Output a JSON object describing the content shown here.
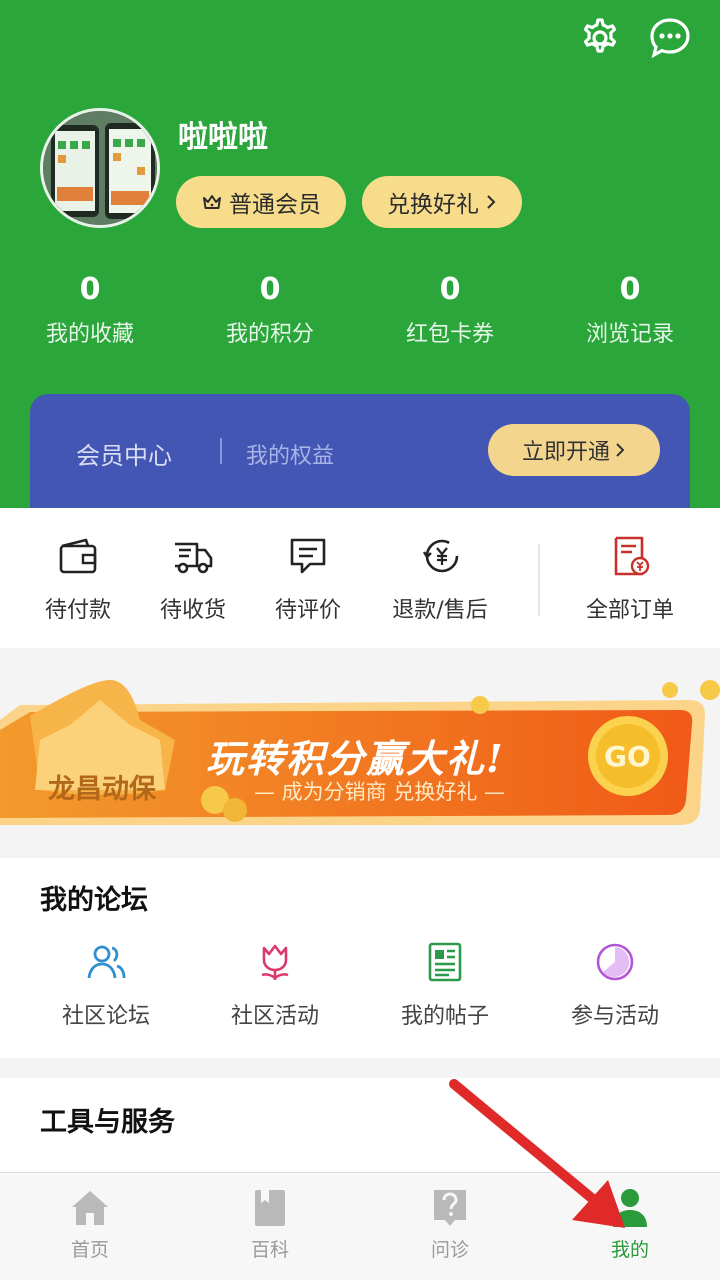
{
  "profile": {
    "username": "啦啦啦",
    "member_label": "普通会员",
    "gift_label": "兑换好礼"
  },
  "stats": [
    {
      "value": "0",
      "label": "我的收藏"
    },
    {
      "value": "0",
      "label": "我的积分"
    },
    {
      "value": "0",
      "label": "红包卡券"
    },
    {
      "value": "0",
      "label": "浏览记录"
    }
  ],
  "vip": {
    "title": "会员中心",
    "subtitle": "我的权益",
    "button": "立即开通"
  },
  "orders": [
    {
      "label": "待付款",
      "icon": "wallet-icon"
    },
    {
      "label": "待收货",
      "icon": "truck-icon"
    },
    {
      "label": "待评价",
      "icon": "comment-icon"
    },
    {
      "label": "退款/售后",
      "icon": "refund-icon"
    },
    {
      "label": "全部订单",
      "icon": "receipt-icon"
    }
  ],
  "banner": {
    "brand": "龙昌动保",
    "headline": "玩转积分赢大礼!",
    "subline": "— 成为分销商 兑换好礼 —",
    "go": "GO"
  },
  "forum": {
    "title": "我的论坛",
    "items": [
      {
        "label": "社区论坛",
        "icon": "people-icon"
      },
      {
        "label": "社区活动",
        "icon": "tulip-icon"
      },
      {
        "label": "我的帖子",
        "icon": "newspaper-icon"
      },
      {
        "label": "参与活动",
        "icon": "pie-icon"
      }
    ]
  },
  "tools": {
    "title": "工具与服务"
  },
  "tabbar": [
    {
      "label": "首页",
      "icon": "home-icon"
    },
    {
      "label": "百科",
      "icon": "book-icon"
    },
    {
      "label": "问诊",
      "icon": "question-icon"
    },
    {
      "label": "我的",
      "icon": "person-icon",
      "active": true
    }
  ],
  "colors": {
    "header_green": "#2aa63a",
    "vip_blue": "#4356b4",
    "pill_gold": "#f7dc8c",
    "active_tab": "#2a9a3a",
    "banner_orange": "#f07a1e"
  }
}
